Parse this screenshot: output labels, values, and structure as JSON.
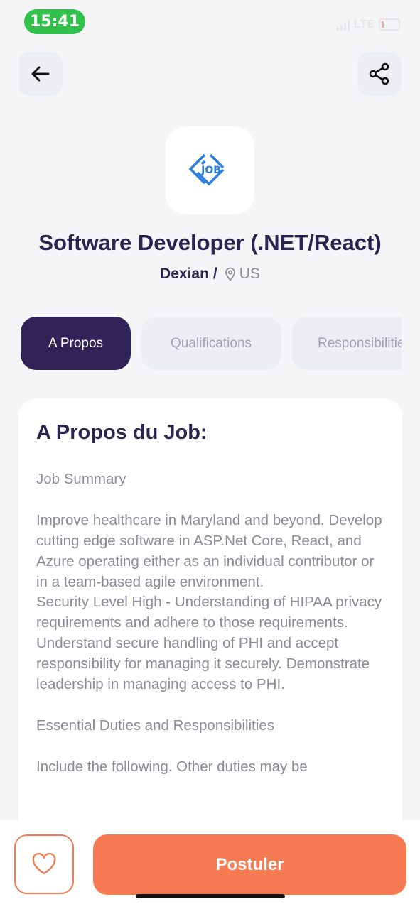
{
  "status_bar": {
    "time": "15:41",
    "network": "LTE",
    "time_pill_color": "#30c14a"
  },
  "nav": {
    "back_icon": "arrow-left-icon",
    "share_icon": "share-icon"
  },
  "job": {
    "logo_text": "JOB",
    "title": "Software Developer (.NET/React)",
    "company": "Dexian",
    "separator": "/",
    "location": "US"
  },
  "tabs": [
    {
      "label": "A Propos",
      "active": true
    },
    {
      "label": "Qualifications",
      "active": false
    },
    {
      "label": "Responsibilities",
      "active": false
    }
  ],
  "about": {
    "heading": "A Propos du Job:",
    "paragraphs": [
      "Job Summary",
      "Improve healthcare in Maryland and beyond. Develop cutting edge software in ASP.Net Core, React, and Azure operating either as an individual contributor or in a team-based agile environment.",
      "Security Level High - Understanding of HIPAA privacy requirements and adhere to those requirements. Understand secure handling of PHI and accept responsibility for managing it securely. Demonstrate leadership in managing access to PHI.",
      "Essential Duties and Responsibilities",
      "Include the following. Other duties may be"
    ]
  },
  "actions": {
    "favorite_icon": "heart-icon",
    "apply_label": "Postuler"
  },
  "colors": {
    "primary_dark": "#2f2358",
    "accent": "#f67b53",
    "background": "#f5f5f7",
    "logo_blue": "#2a7de1"
  }
}
